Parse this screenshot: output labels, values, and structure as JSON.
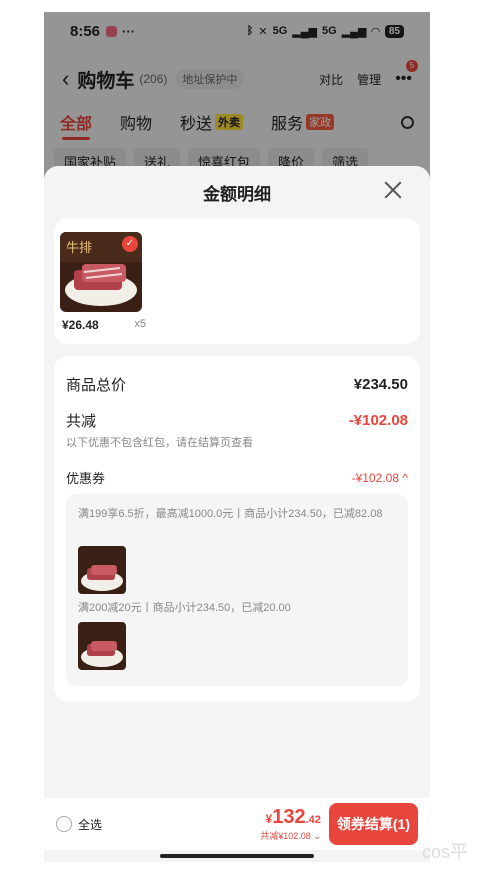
{
  "status_bar": {
    "time": "8:56",
    "dots": "···",
    "network_1": "5G",
    "network_2": "5G",
    "battery": "85"
  },
  "header": {
    "back": "‹",
    "title": "购物车",
    "count": "(206)",
    "address": "地址保护中",
    "compare": "对比",
    "manage": "管理",
    "more_badge": "5"
  },
  "tabs": [
    {
      "label": "全部"
    },
    {
      "label": "购物"
    },
    {
      "label": "秒送",
      "tag": "外卖"
    },
    {
      "label": "服务",
      "tag": "家政"
    }
  ],
  "filters": [
    "国家补贴",
    "送礼",
    "惊喜红包",
    "降价",
    "筛选"
  ],
  "sheet": {
    "title": "金额明细",
    "product": {
      "price": "¥26.48",
      "quantity": "x5"
    },
    "total_label": "商品总价",
    "total_value": "¥234.50",
    "discount_label": "共减",
    "discount_value": "-¥102.08",
    "discount_note": "以下优惠不包含红包，请在结算页查看",
    "coupon_label": "优惠券",
    "coupon_value": "-¥102.08",
    "coupon_toggle": "^",
    "coupons": [
      {
        "text": "满199享6.5折，最高减1000.0元丨商品小计234.50，已减82.08"
      },
      {
        "text": "满200减20元丨商品小计234.50，已减20.00"
      }
    ]
  },
  "bottom": {
    "select_all": "全选",
    "yen": "¥",
    "total_int": "132",
    "total_dec": ".42",
    "saved": "共减¥102.08",
    "pay_button": "领券结算(1)"
  },
  "watermark": "cos平"
}
